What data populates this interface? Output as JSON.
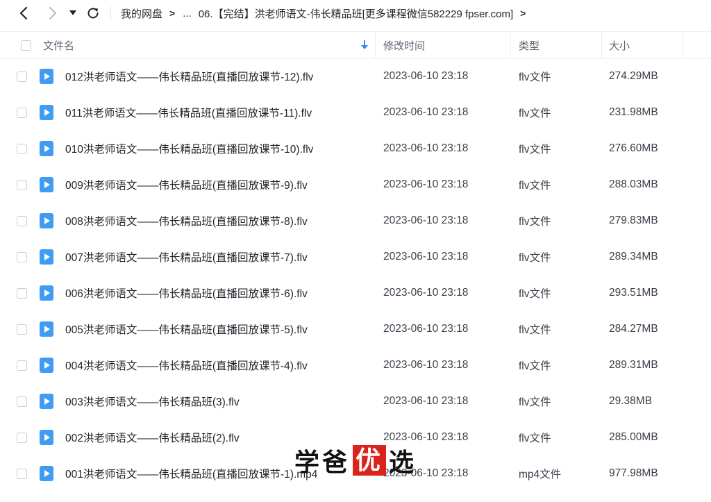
{
  "nav": {
    "back_icon": "chevron-left-icon",
    "forward_icon": "chevron-right-icon",
    "dropdown_icon": "caret-down-icon",
    "refresh_icon": "refresh-icon"
  },
  "breadcrumb": {
    "root": "我的网盘",
    "ellipsis": "...",
    "current": "06.【完结】洪老师语文-伟长精品班[更多课程微信582229 fpser.com]"
  },
  "table": {
    "columns": {
      "name": "文件名",
      "time": "修改时间",
      "type": "类型",
      "size": "大小"
    },
    "sort_icon": "sort-down-arrow-icon",
    "rows": [
      {
        "name": "012洪老师语文——伟长精品班(直播回放课节-12).flv",
        "time": "2023-06-10 23:18",
        "type": "flv文件",
        "size": "274.29MB"
      },
      {
        "name": "011洪老师语文——伟长精品班(直播回放课节-11).flv",
        "time": "2023-06-10 23:18",
        "type": "flv文件",
        "size": "231.98MB"
      },
      {
        "name": "010洪老师语文——伟长精品班(直播回放课节-10).flv",
        "time": "2023-06-10 23:18",
        "type": "flv文件",
        "size": "276.60MB"
      },
      {
        "name": "009洪老师语文——伟长精品班(直播回放课节-9).flv",
        "time": "2023-06-10 23:18",
        "type": "flv文件",
        "size": "288.03MB"
      },
      {
        "name": "008洪老师语文——伟长精品班(直播回放课节-8).flv",
        "time": "2023-06-10 23:18",
        "type": "flv文件",
        "size": "279.83MB"
      },
      {
        "name": "007洪老师语文——伟长精品班(直播回放课节-7).flv",
        "time": "2023-06-10 23:18",
        "type": "flv文件",
        "size": "289.34MB"
      },
      {
        "name": "006洪老师语文——伟长精品班(直播回放课节-6).flv",
        "time": "2023-06-10 23:18",
        "type": "flv文件",
        "size": "293.51MB"
      },
      {
        "name": "005洪老师语文——伟长精品班(直播回放课节-5).flv",
        "time": "2023-06-10 23:18",
        "type": "flv文件",
        "size": "284.27MB"
      },
      {
        "name": "004洪老师语文——伟长精品班(直播回放课节-4).flv",
        "time": "2023-06-10 23:18",
        "type": "flv文件",
        "size": "289.31MB"
      },
      {
        "name": "003洪老师语文——伟长精品班(3).flv",
        "time": "2023-06-10 23:18",
        "type": "flv文件",
        "size": "29.38MB"
      },
      {
        "name": "002洪老师语文——伟长精品班(2).flv",
        "time": "2023-06-10 23:18",
        "type": "flv文件",
        "size": "285.00MB"
      },
      {
        "name": "001洪老师语文——伟长精品班(直播回放课节-1).mp4",
        "time": "2023-06-10 23:18",
        "type": "mp4文件",
        "size": "977.98MB"
      }
    ]
  },
  "watermark": {
    "part1": "学爸",
    "highlight": "优",
    "part2": "选"
  },
  "colors": {
    "accent": "#3f9cf2",
    "watermark_red": "#d9231b"
  }
}
